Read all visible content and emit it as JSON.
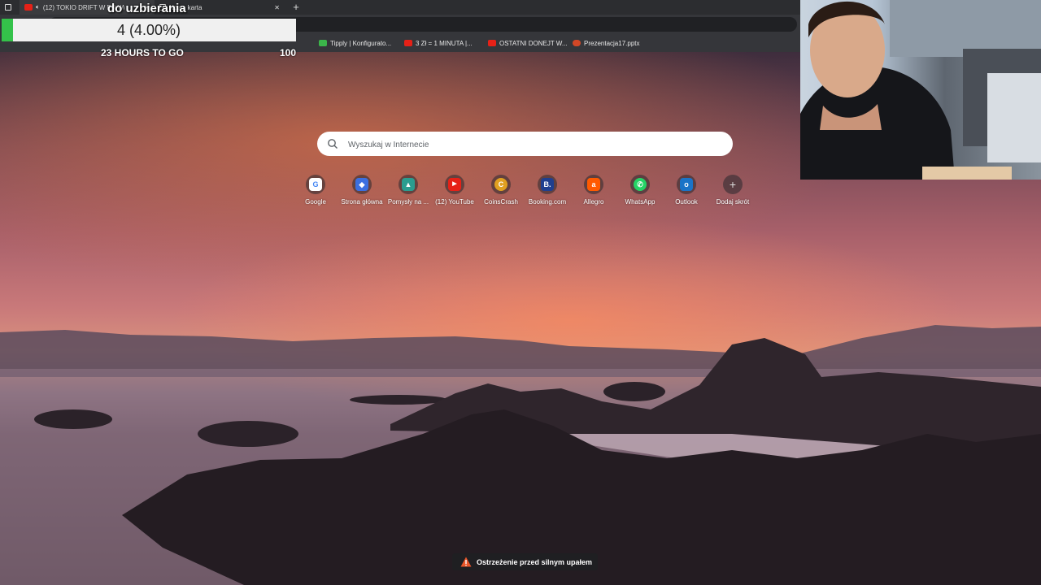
{
  "overlay": {
    "goal_title": "do uzbierania",
    "goal_value": "4 (4.00%)",
    "goal_progress_fraction": 0.04,
    "time_left": "23 HOURS TO GO",
    "goal_target": "100",
    "progress_color": "#34c24a"
  },
  "tabs": [
    {
      "label": "(12) TOKIO DRIFT W PRAWI",
      "icon": "youtube-icon"
    },
    {
      "label": "Nowa karta",
      "icon": "new-tab-icon"
    }
  ],
  "bookmarks": [
    {
      "label": "Tipply | Konfigurato...",
      "icon": "tipply-icon",
      "color": "#3bb54a"
    },
    {
      "label": "3 Zł = 1 MINUTA |...",
      "icon": "youtube-icon",
      "color": "#e62117"
    },
    {
      "label": "OSTATNI DONEJT W...",
      "icon": "youtube-icon",
      "color": "#e62117"
    },
    {
      "label": "Prezentacja17.pptx",
      "icon": "powerpoint-icon",
      "color": "#d24726"
    }
  ],
  "search": {
    "placeholder": "Wyszukaj w Internecie"
  },
  "shortcuts": [
    {
      "label": "Google",
      "icon": "google-icon",
      "color": "#ffffff",
      "glyph": "G"
    },
    {
      "label": "Strona główna",
      "icon": "roblox-icon",
      "color": "#3b6fe0",
      "glyph": "◆"
    },
    {
      "label": "Pomysły na ...",
      "icon": "ideas-icon",
      "color": "#2a9d8f",
      "glyph": "▲"
    },
    {
      "label": "(12) YouTube",
      "icon": "youtube-icon",
      "color": "#e62117",
      "glyph": "▶"
    },
    {
      "label": "CoinsCrash",
      "icon": "coinscrash-icon",
      "color": "#e0a020",
      "glyph": "C"
    },
    {
      "label": "Booking.com",
      "icon": "booking-icon",
      "color": "#1f3f8f",
      "glyph": "B."
    },
    {
      "label": "Allegro",
      "icon": "allegro-icon",
      "color": "#ff5a00",
      "glyph": "a"
    },
    {
      "label": "WhatsApp",
      "icon": "whatsapp-icon",
      "color": "#25d366",
      "glyph": "✆"
    },
    {
      "label": "Outlook",
      "icon": "outlook-icon",
      "color": "#1a73c7",
      "glyph": "o"
    },
    {
      "label": "Dodaj skrót",
      "icon": "plus-icon",
      "color": "rgba(0,0,0,0)",
      "glyph": "+"
    }
  ],
  "weather_alert": {
    "text": "Ostrzeżenie przed silnym upałem",
    "icon": "warning-icon",
    "color": "#e8562a"
  }
}
